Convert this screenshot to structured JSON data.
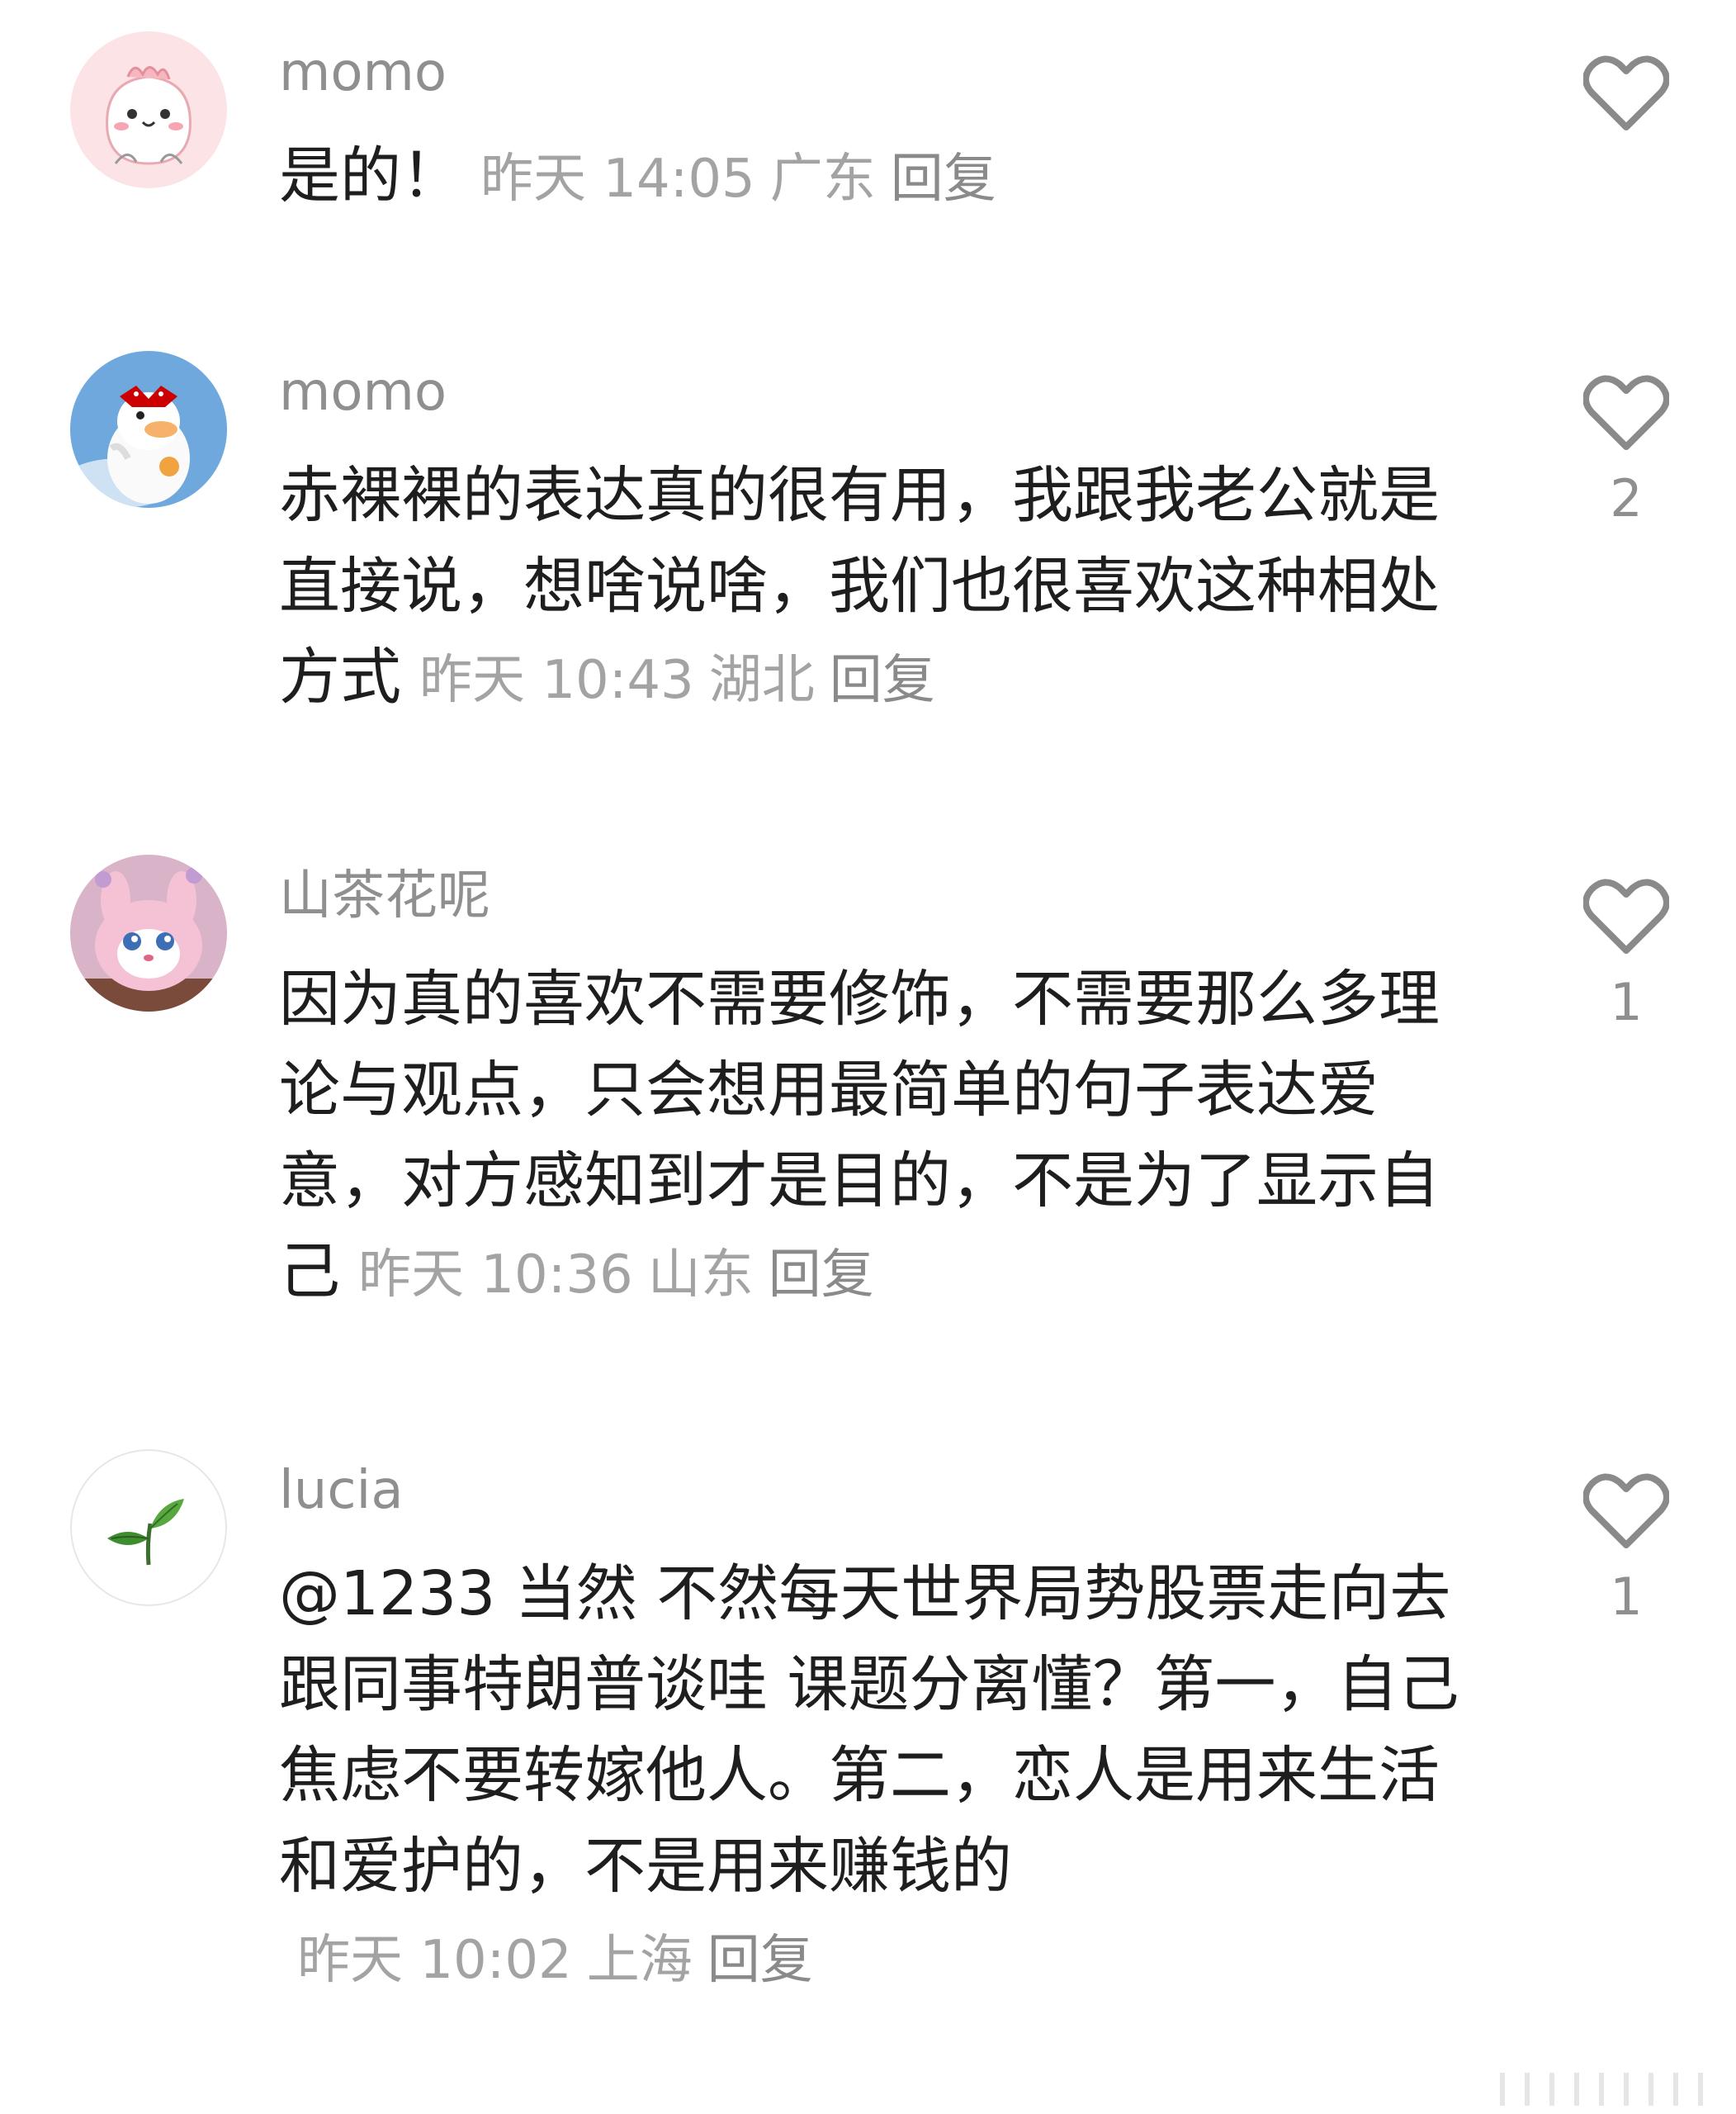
{
  "comments": [
    {
      "username": "momo",
      "text": "是的！",
      "time": "昨天 14:05",
      "location": "广东",
      "reply_label": "回复",
      "like_count": "",
      "avatar": "pink-blob-icon"
    },
    {
      "username": "momo",
      "text": "赤裸裸的表达真的很有用，我跟我老公就是直接说，想啥说啥，我们也很喜欢这种相处方式",
      "time": "昨天 10:43",
      "location": "湖北",
      "reply_label": "回复",
      "like_count": "2",
      "avatar": "duck-with-bow-icon"
    },
    {
      "username": "山茶花呢",
      "text": "因为真的喜欢不需要修饰，不需要那么多理论与观点，只会想用最简单的句子表达爱意，对方感知到才是目的，不是为了显示自己",
      "time": "昨天 10:36",
      "location": "山东",
      "reply_label": "回复",
      "like_count": "1",
      "avatar": "pink-bunny-icon"
    },
    {
      "username": "lucia",
      "text": "@1233 当然 不然每天世界局势股票走向去跟同事特朗普谈哇 课题分离懂？第一，自己焦虑不要转嫁他人。第二，恋人是用来生活和爱护的，不是用来赚钱的",
      "time": "昨天 10:02",
      "location": "上海",
      "reply_label": "回复",
      "like_count": "1",
      "avatar": "sprout-icon"
    }
  ],
  "icons": {
    "like": "heart-outline-icon"
  },
  "colors": {
    "username": "#8f8f8f",
    "meta": "#a3a3a3",
    "text": "#1e1e1e",
    "heart_stroke": "#8a8a8a"
  }
}
